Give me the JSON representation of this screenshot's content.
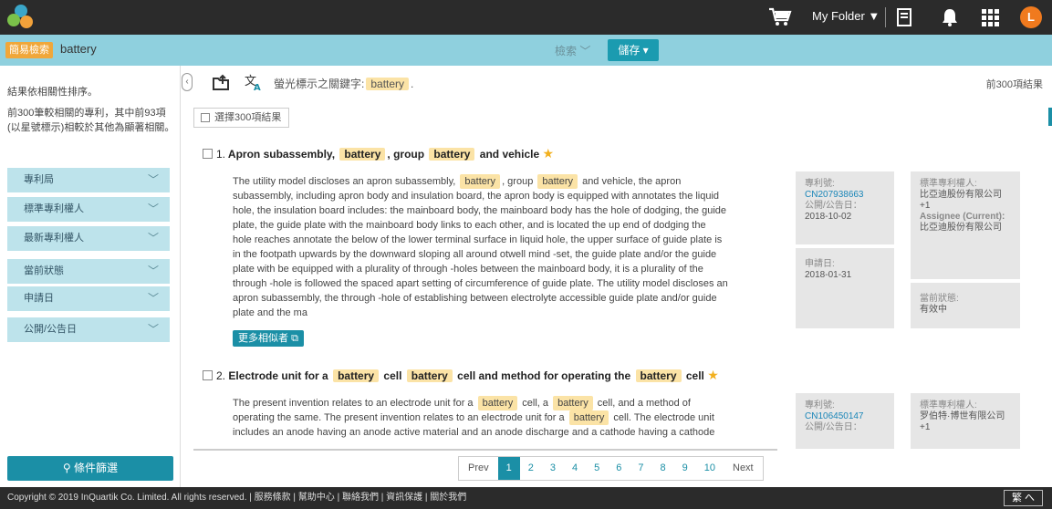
{
  "topbar": {
    "folder_label": "My Folder ▼",
    "avatar_letter": "L",
    "colors": {
      "bg": "#2b2b2b",
      "avatar": "#f07a1e"
    }
  },
  "search": {
    "tag": "簡易檢索",
    "query": "battery",
    "search_label": "檢索",
    "save_label": "儲存 ▾"
  },
  "sidebar": {
    "sort_note": "結果依相關性排序。",
    "desc_note": "前300筆較相關的專利，其中前93項(以星號標示)相較於其他為顯著相關。",
    "facets": [
      "專利局",
      "標準專利權人",
      "最新專利權人",
      "當前狀態",
      "申請日",
      "公開/公告日"
    ],
    "filter_button": "條件篩選"
  },
  "main": {
    "highlight_label": "螢光標示之關鍵字:",
    "highlight_word": "battery",
    "count_right": "前300項結果",
    "select_all": "選擇300項結果",
    "similar_button": "更多相似者"
  },
  "results": [
    {
      "num": "1.",
      "title_parts": [
        "Apron subassembly,",
        "battery",
        ", group",
        "battery",
        "and vehicle"
      ],
      "abstract_lines": [
        [
          "The utility model discloses an apron subassembly, ",
          "battery",
          ", group ",
          "battery",
          " and vehicle, the apron"
        ],
        [
          "subassembly, including apron body and insulation board, the apron body is equipped with annotates the liquid"
        ],
        [
          "hole, the insulation board includes: the mainboard body, the mainboard body has the hole of dodging, the guide"
        ],
        [
          "plate, the guide plate with the mainboard body links to each other, and is located the up end of dodging the"
        ],
        [
          "hole reaches annotate the below of the lower terminal surface in liquid hole, the upper surface of guide plate is"
        ],
        [
          "in the footpath upwards by the downward sloping all around otwell mind -set, the guide plate and/or the guide"
        ],
        [
          "plate with be equipped with a plurality of through -holes between the mainboard body, it is a plurality of the"
        ],
        [
          "through -hole is followed the spaced apart setting of circumference of guide plate. The utility model discloses an"
        ],
        [
          "apron subassembly, the through -hole of establishing between electrolyte accessible guide plate and/or guide"
        ],
        [
          "plate and the ma"
        ]
      ],
      "meta1": {
        "pn_label": "專利號:",
        "pn": "CN207938663",
        "pub_label": "公開/公告日：",
        "pub": "2018-10-02"
      },
      "meta2": {
        "app_label": "申請日:",
        "app": "2018-01-31"
      },
      "meta3": {
        "assignee_label": "標準專利權人:",
        "assignee": "比亞迪股份有限公司 +1",
        "current_label": "Assignee (Current):",
        "current": "比亞迪股份有限公司"
      },
      "meta4": {
        "status_label": "當前狀態:",
        "status": "有效中"
      }
    },
    {
      "num": "2.",
      "title_parts": [
        "Electrode unit for a",
        "battery",
        "cell",
        "battery",
        "cell and method for operating the",
        "battery",
        "cell"
      ],
      "abstract_lines": [
        [
          "The present invention relates to an electrode unit for a ",
          "battery",
          " cell, a ",
          "battery",
          " cell, and a method of"
        ],
        [
          "operating the same. The present invention relates to an electrode unit for a ",
          "battery",
          " cell. The electrode unit"
        ],
        [
          "includes an anode having an anode active material and an anode discharge and a cathode having a cathode"
        ]
      ],
      "meta1": {
        "pn_label": "專利號:",
        "pn": "CN106450147",
        "pub_label": "公開/公告日："
      },
      "meta3": {
        "assignee_label": "標準專利權人:",
        "assignee": "罗伯特·博世有限公司 +1"
      }
    }
  ],
  "pager": {
    "prev": "Prev",
    "pages": [
      "1",
      "2",
      "3",
      "4",
      "5",
      "6",
      "7",
      "8",
      "9",
      "10"
    ],
    "next": "Next",
    "active": "1"
  },
  "footer": {
    "text": "Copyright © 2019 InQuartik Co. Limited. All rights reserved. | 服務條款 | 幫助中心 | 聯絡我們 | 資訊保護 | 關於我們",
    "lang": "繁 へ"
  }
}
